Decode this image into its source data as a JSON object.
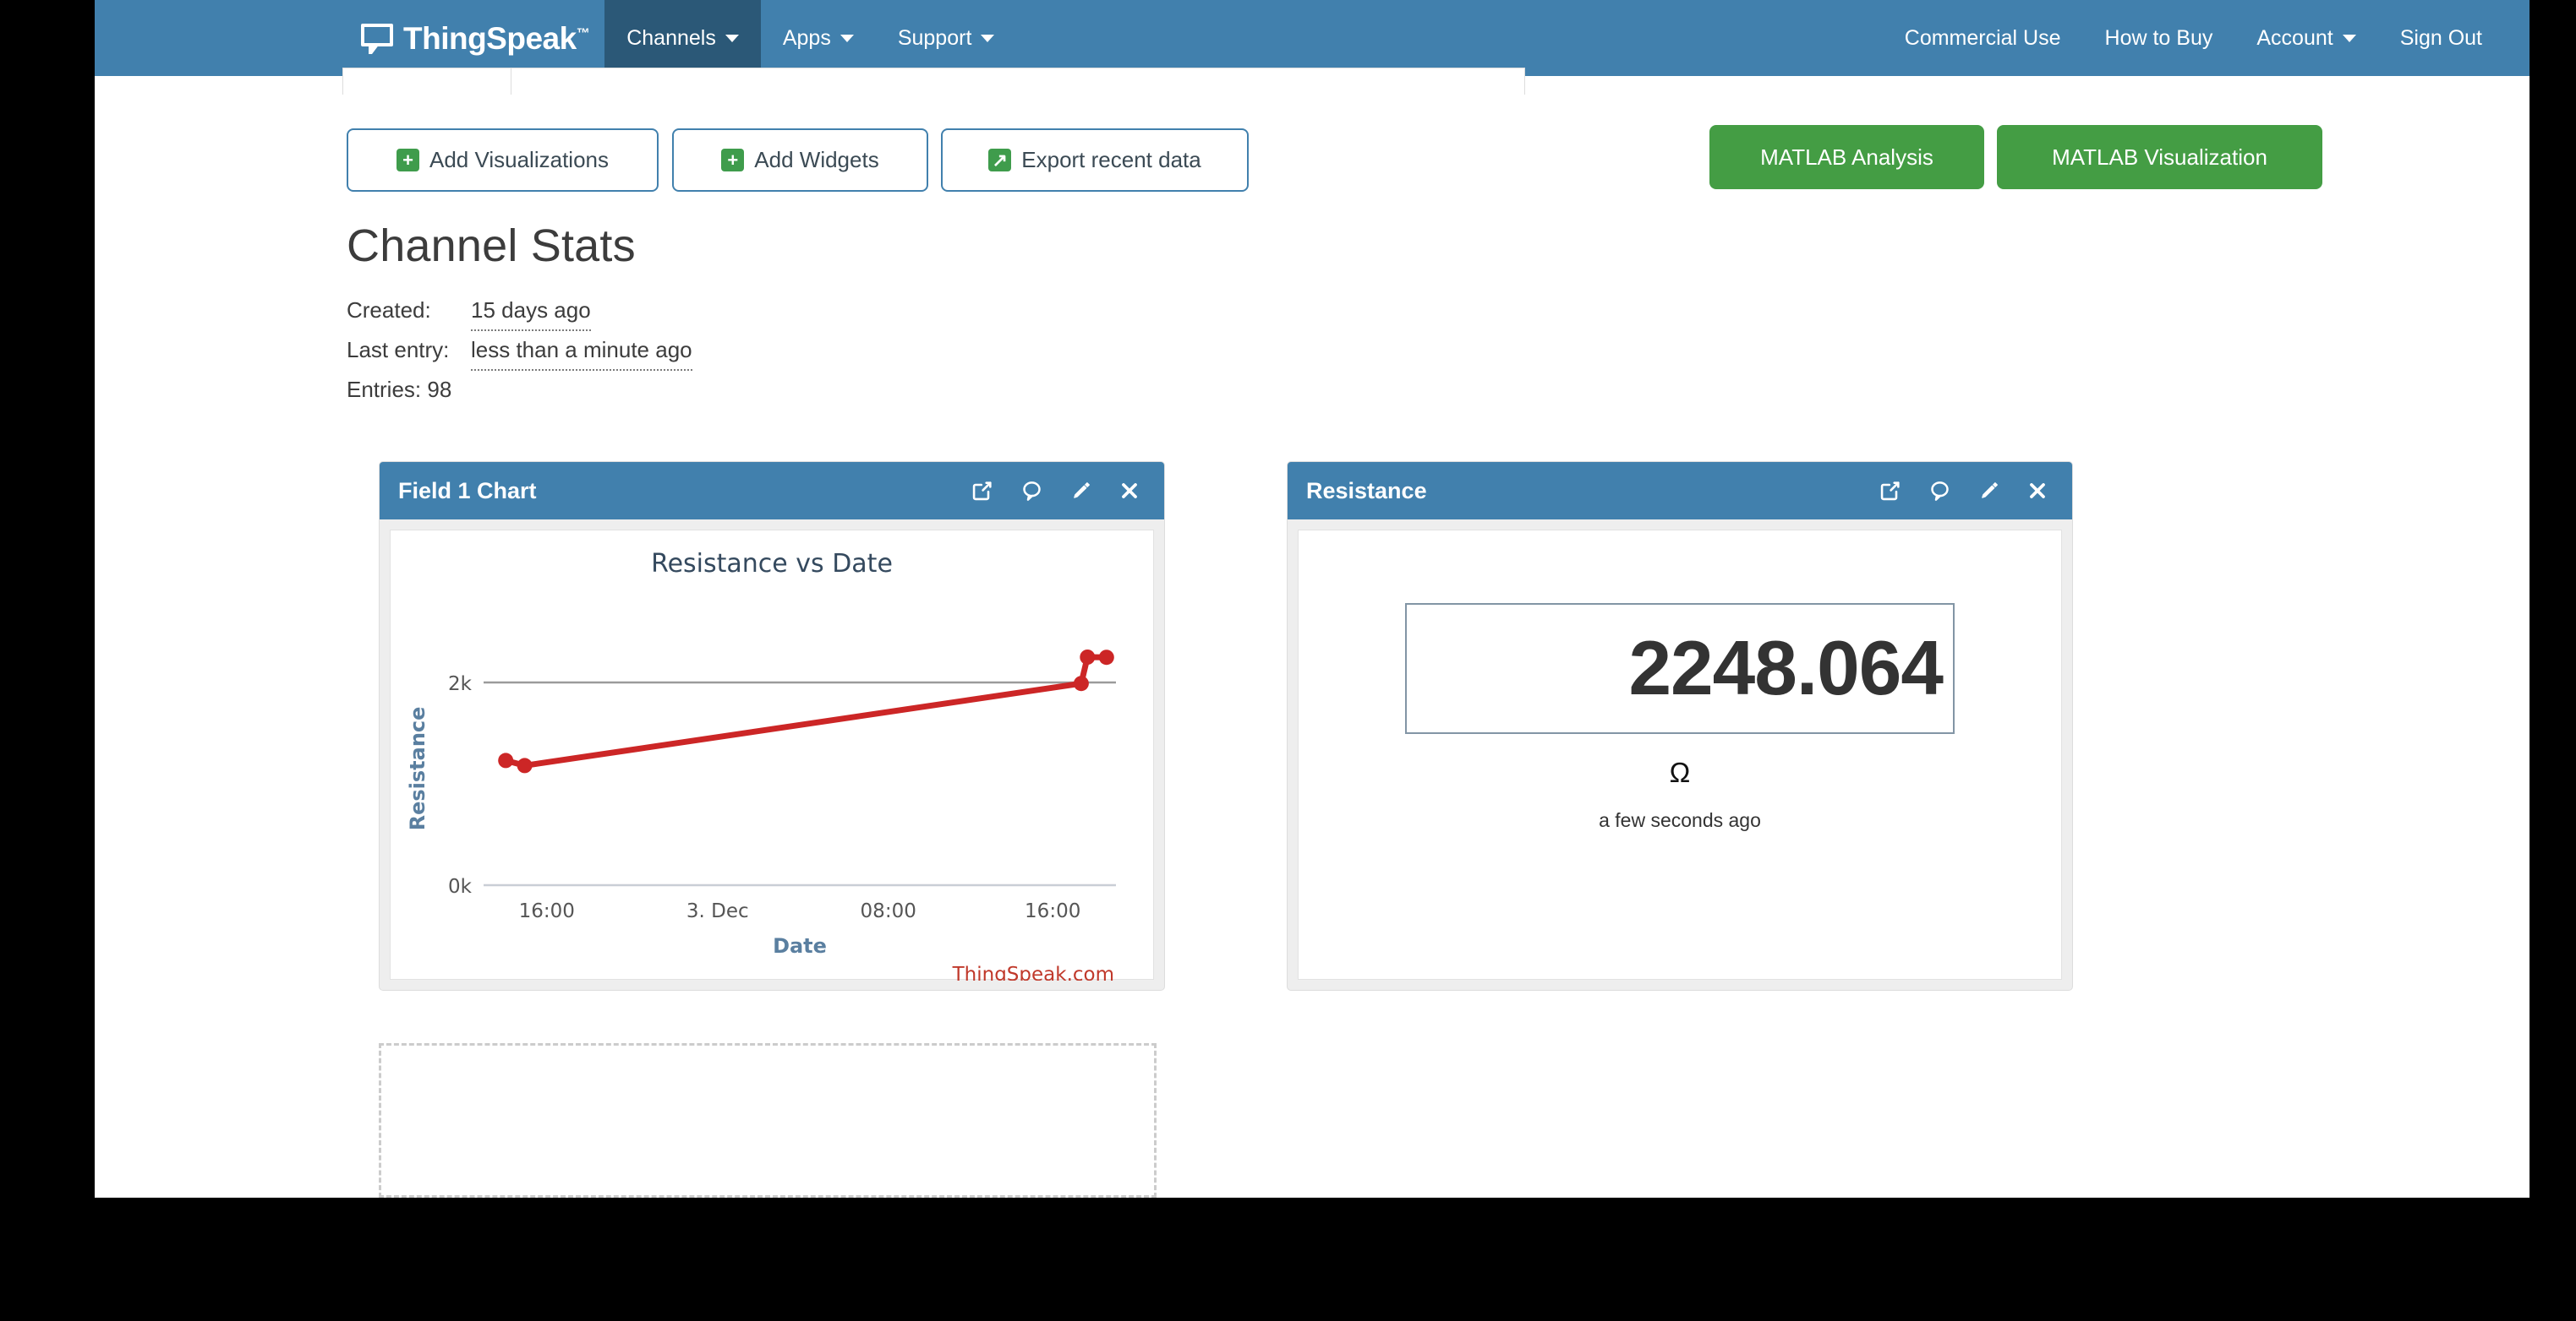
{
  "navbar": {
    "brand": "ThingSpeak",
    "brand_tm": "™",
    "brand_logo_icon": "speech-bubble-logo-icon",
    "left_items": [
      {
        "label": "Channels",
        "has_caret": true,
        "active": true
      },
      {
        "label": "Apps",
        "has_caret": true,
        "active": false
      },
      {
        "label": "Support",
        "has_caret": true,
        "active": false
      }
    ],
    "right_items": [
      {
        "label": "Commercial Use",
        "has_caret": false
      },
      {
        "label": "How to Buy",
        "has_caret": false
      },
      {
        "label": "Account",
        "has_caret": true
      },
      {
        "label": "Sign Out",
        "has_caret": false
      }
    ]
  },
  "toolbar": {
    "add_visualizations": "Add Visualizations",
    "add_visualizations_icon": "plus-square-icon",
    "add_widgets": "Add Widgets",
    "add_widgets_icon": "plus-square-icon",
    "export_recent_data": "Export recent data",
    "export_recent_data_icon": "external-arrow-square-icon",
    "matlab_analysis": "MATLAB Analysis",
    "matlab_visualization": "MATLAB Visualization"
  },
  "stats": {
    "heading": "Channel Stats",
    "created_label": "Created:",
    "created_value": "15 days ago",
    "last_entry_label": "Last entry:",
    "last_entry_value": "less than a minute ago",
    "entries_line": "Entries: 98",
    "entries_count": 98
  },
  "panels": {
    "chart_panel": {
      "title": "Field 1 Chart",
      "icons": [
        {
          "name": "external-link-icon",
          "glyph": "external-link"
        },
        {
          "name": "comment-icon",
          "glyph": "comment"
        },
        {
          "name": "edit-pencil-icon",
          "glyph": "pencil"
        },
        {
          "name": "close-icon",
          "glyph": "x"
        }
      ]
    },
    "gauge_panel": {
      "title": "Resistance",
      "icons": [
        {
          "name": "external-link-icon",
          "glyph": "external-link"
        },
        {
          "name": "comment-icon",
          "glyph": "comment"
        },
        {
          "name": "edit-pencil-icon",
          "glyph": "pencil"
        },
        {
          "name": "close-icon",
          "glyph": "x"
        }
      ],
      "value": "2248.064",
      "unit": "Ω",
      "timestamp": "a few seconds ago"
    }
  },
  "chart_data": {
    "type": "line",
    "title": "Resistance vs Date",
    "xlabel": "Date",
    "ylabel": "Resistance",
    "watermark": "ThingSpeak.com",
    "series_color": "#cc2626",
    "grid": true,
    "legend": false,
    "ylim": [
      0,
      2500
    ],
    "yticks": [
      0,
      2000
    ],
    "ytick_labels": [
      "0k",
      "2k"
    ],
    "xtick_labels": [
      "16:00",
      "3. Dec",
      "08:00",
      "16:00"
    ],
    "xtick_positions": [
      0.1,
      0.37,
      0.64,
      0.9
    ],
    "points": [
      {
        "x": 0.035,
        "y": 1230
      },
      {
        "x": 0.065,
        "y": 1180
      },
      {
        "x": 0.945,
        "y": 1990
      },
      {
        "x": 0.955,
        "y": 2250
      },
      {
        "x": 0.985,
        "y": 2248
      }
    ],
    "series": [
      {
        "name": "Resistance",
        "values": [
          1230,
          1180,
          1990,
          2250,
          2248
        ]
      }
    ]
  },
  "dropzone": {
    "name": "empty-widget-dropzone"
  },
  "colors": {
    "nav_blue": "#4180ad",
    "nav_active_blue": "#2b5877",
    "green": "#449d44",
    "icon_green": "#3f9c4c",
    "chart_red": "#cc2626",
    "axis_blue": "#5a7fa0",
    "text_dark": "#3c3c3c"
  }
}
